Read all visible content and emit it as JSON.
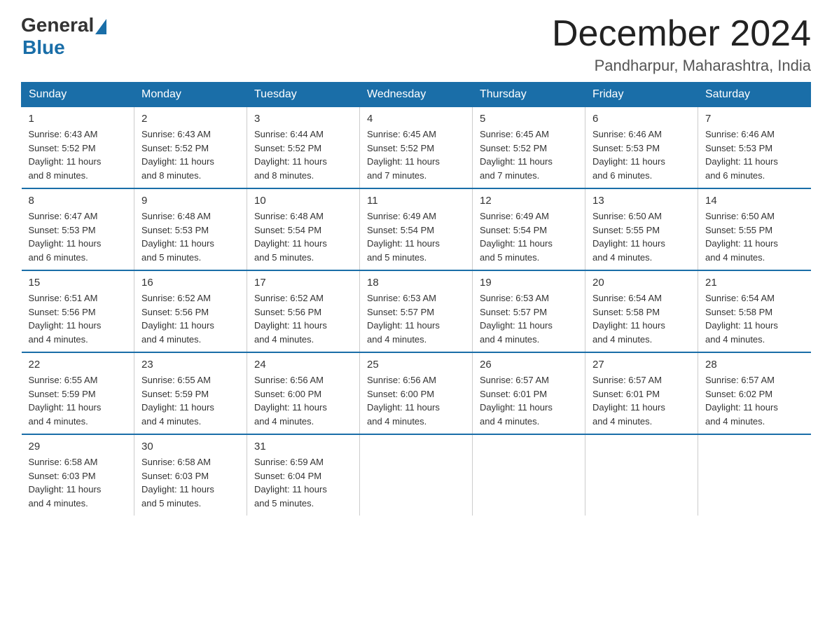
{
  "logo": {
    "general": "General",
    "blue": "Blue"
  },
  "title": {
    "month_year": "December 2024",
    "location": "Pandharpur, Maharashtra, India"
  },
  "days_of_week": [
    "Sunday",
    "Monday",
    "Tuesday",
    "Wednesday",
    "Thursday",
    "Friday",
    "Saturday"
  ],
  "weeks": [
    [
      {
        "date": "1",
        "sunrise": "6:43 AM",
        "sunset": "5:52 PM",
        "daylight": "11 hours and 8 minutes."
      },
      {
        "date": "2",
        "sunrise": "6:43 AM",
        "sunset": "5:52 PM",
        "daylight": "11 hours and 8 minutes."
      },
      {
        "date": "3",
        "sunrise": "6:44 AM",
        "sunset": "5:52 PM",
        "daylight": "11 hours and 8 minutes."
      },
      {
        "date": "4",
        "sunrise": "6:45 AM",
        "sunset": "5:52 PM",
        "daylight": "11 hours and 7 minutes."
      },
      {
        "date": "5",
        "sunrise": "6:45 AM",
        "sunset": "5:52 PM",
        "daylight": "11 hours and 7 minutes."
      },
      {
        "date": "6",
        "sunrise": "6:46 AM",
        "sunset": "5:53 PM",
        "daylight": "11 hours and 6 minutes."
      },
      {
        "date": "7",
        "sunrise": "6:46 AM",
        "sunset": "5:53 PM",
        "daylight": "11 hours and 6 minutes."
      }
    ],
    [
      {
        "date": "8",
        "sunrise": "6:47 AM",
        "sunset": "5:53 PM",
        "daylight": "11 hours and 6 minutes."
      },
      {
        "date": "9",
        "sunrise": "6:48 AM",
        "sunset": "5:53 PM",
        "daylight": "11 hours and 5 minutes."
      },
      {
        "date": "10",
        "sunrise": "6:48 AM",
        "sunset": "5:54 PM",
        "daylight": "11 hours and 5 minutes."
      },
      {
        "date": "11",
        "sunrise": "6:49 AM",
        "sunset": "5:54 PM",
        "daylight": "11 hours and 5 minutes."
      },
      {
        "date": "12",
        "sunrise": "6:49 AM",
        "sunset": "5:54 PM",
        "daylight": "11 hours and 5 minutes."
      },
      {
        "date": "13",
        "sunrise": "6:50 AM",
        "sunset": "5:55 PM",
        "daylight": "11 hours and 4 minutes."
      },
      {
        "date": "14",
        "sunrise": "6:50 AM",
        "sunset": "5:55 PM",
        "daylight": "11 hours and 4 minutes."
      }
    ],
    [
      {
        "date": "15",
        "sunrise": "6:51 AM",
        "sunset": "5:56 PM",
        "daylight": "11 hours and 4 minutes."
      },
      {
        "date": "16",
        "sunrise": "6:52 AM",
        "sunset": "5:56 PM",
        "daylight": "11 hours and 4 minutes."
      },
      {
        "date": "17",
        "sunrise": "6:52 AM",
        "sunset": "5:56 PM",
        "daylight": "11 hours and 4 minutes."
      },
      {
        "date": "18",
        "sunrise": "6:53 AM",
        "sunset": "5:57 PM",
        "daylight": "11 hours and 4 minutes."
      },
      {
        "date": "19",
        "sunrise": "6:53 AM",
        "sunset": "5:57 PM",
        "daylight": "11 hours and 4 minutes."
      },
      {
        "date": "20",
        "sunrise": "6:54 AM",
        "sunset": "5:58 PM",
        "daylight": "11 hours and 4 minutes."
      },
      {
        "date": "21",
        "sunrise": "6:54 AM",
        "sunset": "5:58 PM",
        "daylight": "11 hours and 4 minutes."
      }
    ],
    [
      {
        "date": "22",
        "sunrise": "6:55 AM",
        "sunset": "5:59 PM",
        "daylight": "11 hours and 4 minutes."
      },
      {
        "date": "23",
        "sunrise": "6:55 AM",
        "sunset": "5:59 PM",
        "daylight": "11 hours and 4 minutes."
      },
      {
        "date": "24",
        "sunrise": "6:56 AM",
        "sunset": "6:00 PM",
        "daylight": "11 hours and 4 minutes."
      },
      {
        "date": "25",
        "sunrise": "6:56 AM",
        "sunset": "6:00 PM",
        "daylight": "11 hours and 4 minutes."
      },
      {
        "date": "26",
        "sunrise": "6:57 AM",
        "sunset": "6:01 PM",
        "daylight": "11 hours and 4 minutes."
      },
      {
        "date": "27",
        "sunrise": "6:57 AM",
        "sunset": "6:01 PM",
        "daylight": "11 hours and 4 minutes."
      },
      {
        "date": "28",
        "sunrise": "6:57 AM",
        "sunset": "6:02 PM",
        "daylight": "11 hours and 4 minutes."
      }
    ],
    [
      {
        "date": "29",
        "sunrise": "6:58 AM",
        "sunset": "6:03 PM",
        "daylight": "11 hours and 4 minutes."
      },
      {
        "date": "30",
        "sunrise": "6:58 AM",
        "sunset": "6:03 PM",
        "daylight": "11 hours and 5 minutes."
      },
      {
        "date": "31",
        "sunrise": "6:59 AM",
        "sunset": "6:04 PM",
        "daylight": "11 hours and 5 minutes."
      },
      null,
      null,
      null,
      null
    ]
  ],
  "labels": {
    "sunrise": "Sunrise:",
    "sunset": "Sunset:",
    "daylight": "Daylight:"
  }
}
